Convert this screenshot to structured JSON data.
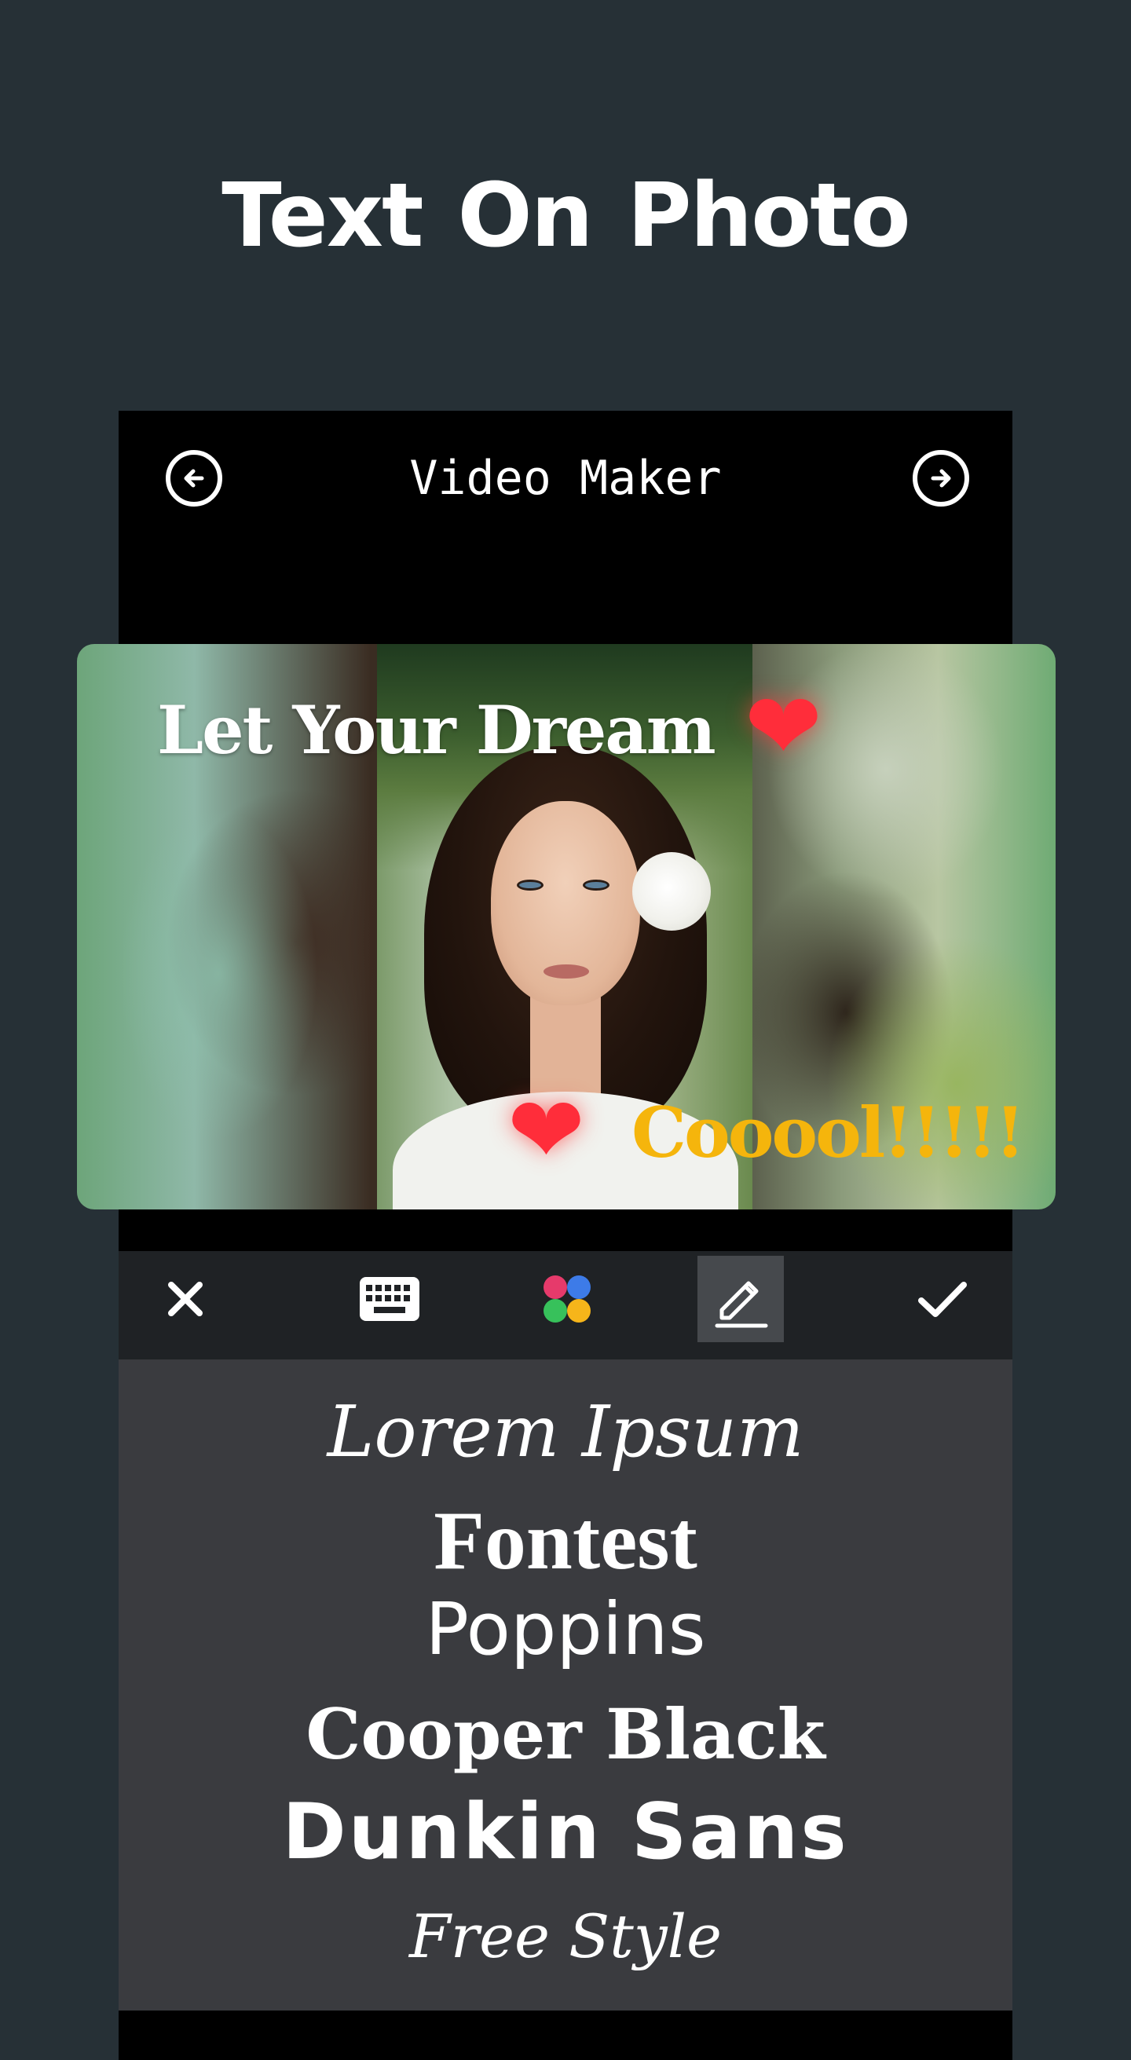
{
  "promo": {
    "title": "Text On Photo"
  },
  "header": {
    "title": "Video Maker",
    "back_icon": "arrow-left-circle-icon",
    "next_icon": "arrow-right-circle-icon"
  },
  "canvas": {
    "overlay_texts": [
      {
        "text": "Let Your Dream",
        "color": "#ffffff"
      },
      {
        "text": "Cooool!!!!!",
        "color": "#f5b50c"
      }
    ],
    "stickers": [
      "heart-sticker",
      "heart-sticker"
    ],
    "heart_glyph": "❤"
  },
  "toolbar": {
    "items": [
      {
        "icon": "close-icon"
      },
      {
        "icon": "keyboard-icon"
      },
      {
        "icon": "color-palette-icon"
      },
      {
        "icon": "pencil-edit-icon",
        "active": true
      },
      {
        "icon": "check-icon"
      }
    ]
  },
  "fonts": {
    "items": [
      {
        "label": "Lorem Ipsum"
      },
      {
        "label": "Fontest"
      },
      {
        "label": "Poppins"
      },
      {
        "label": "Cooper Black"
      },
      {
        "label": "Dunkin  Sans"
      },
      {
        "label": "Free Style"
      }
    ]
  },
  "colors": {
    "background": "#263036",
    "toolbar": "#1f2225",
    "font_panel": "#3a3b3f",
    "accent_yellow": "#f5b50c",
    "heart": "#ff2d3a"
  }
}
